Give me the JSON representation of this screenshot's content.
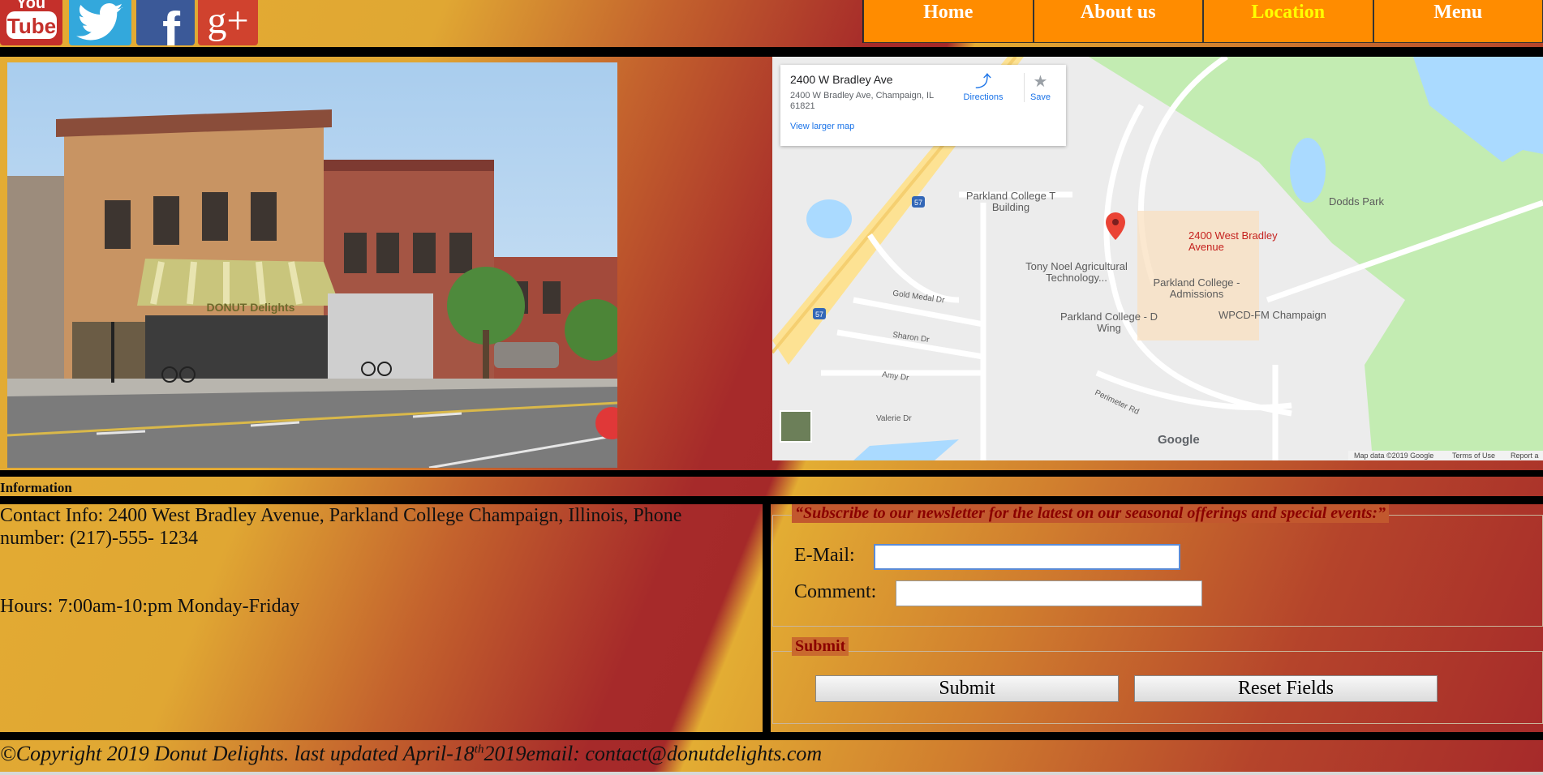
{
  "social": {
    "youtube": "You Tube",
    "twitter": "twitter-icon",
    "facebook": "f",
    "gplus": "g+"
  },
  "nav": {
    "items": [
      "Home",
      "About us",
      "Location",
      "Menu"
    ],
    "active": "Location",
    "bg": "#ff8c00",
    "active_color": "#ffff00"
  },
  "photo": {
    "awning": "DONUT Delights"
  },
  "map": {
    "card": {
      "title": "2400 W Bradley Ave",
      "address": "2400 W Bradley Ave, Champaign, IL 61821",
      "directions": "Directions",
      "save": "Save",
      "larger": "View larger map"
    },
    "labels": {
      "parkland_t": "Parkland College T Building",
      "tony": "Tony Noel Agricultural Technology...",
      "admissions": "Parkland College - Admissions",
      "dwing": "Parkland College - D Wing",
      "wpcd": "WPCD-FM Champaign",
      "dodds": "Dodds Park",
      "pin": "2400 West Bradley Avenue",
      "gold": "Gold Medal Dr",
      "sharon": "Sharon Dr",
      "amy": "Amy Dr",
      "valerie": "Valerie Dr",
      "perimeter": "Perimeter Rd",
      "route": "57"
    },
    "google": "Google",
    "attribution": "Map data ©2019 Google",
    "terms": "Terms of Use",
    "report": "Report a"
  },
  "info": {
    "heading": "Information",
    "contact": "Contact Info: 2400 West Bradley Avenue, Parkland College Champaign, Illinois, Phone number: (217)-555- 1234",
    "hours": "Hours: 7:00am-10:pm Monday-Friday"
  },
  "form": {
    "newsletter_legend": "“Subscribe to our newsletter for the latest on our seasonal offerings and special events:”",
    "email_label": "E-Mail:",
    "comment_label": "Comment:",
    "submit_legend": "Submit",
    "submit_btn": "Submit",
    "reset_btn": "Reset Fields",
    "email_value": "",
    "comment_value": ""
  },
  "footer": {
    "copy": "©Copyright 2019 Donut Delights. last updated April-18",
    "sup": "th",
    "year": "2019",
    "email": "email: contact@donutdelights.com"
  }
}
